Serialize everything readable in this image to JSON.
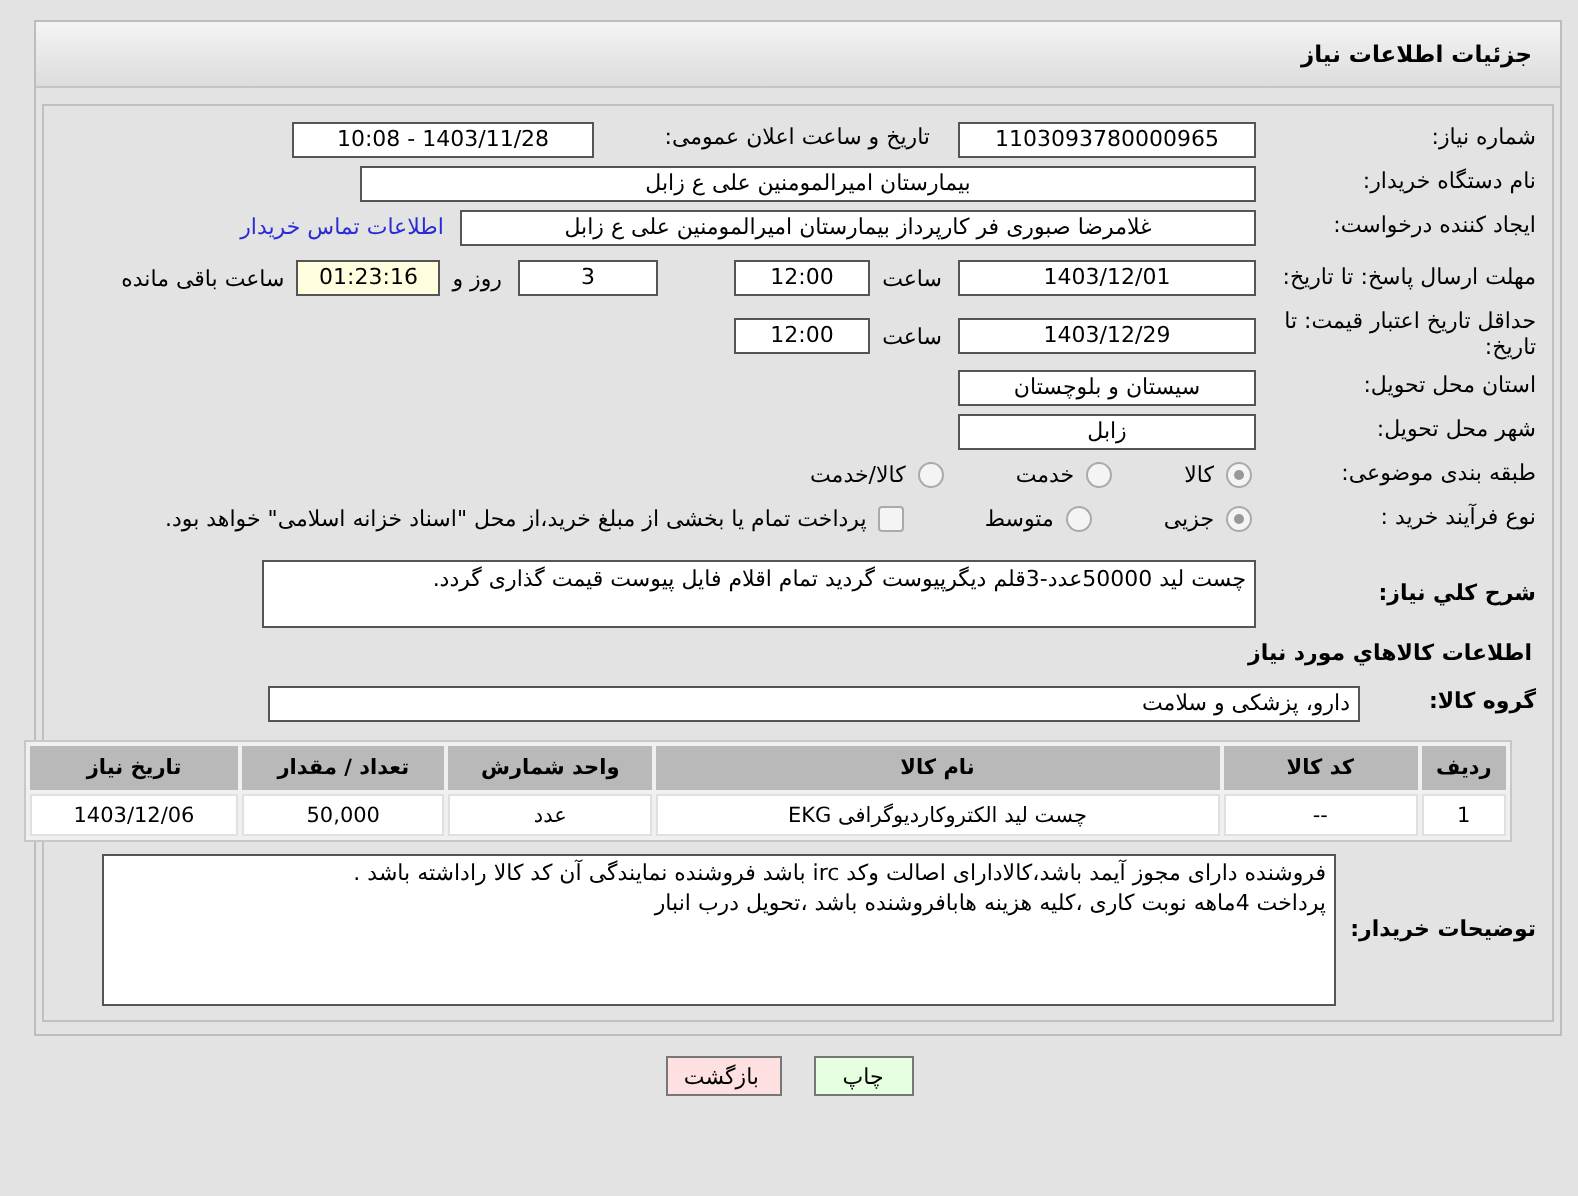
{
  "header": {
    "title": "جزئیات اطلاعات نیاز"
  },
  "need_number": {
    "label": "شماره نیاز:",
    "value": "1103093780000965"
  },
  "announce": {
    "label": "تاریخ و ساعت اعلان عمومی:",
    "value": "1403/11/28 - 10:08"
  },
  "buyer_org": {
    "label": "نام دستگاه خریدار:",
    "value": "بیمارستان امیرالمومنین علی  ع  زابل"
  },
  "creator": {
    "label": "ایجاد کننده درخواست:",
    "value": "غلامرضا صبوری فر کارپرداز بیمارستان امیرالمومنین علی  ع  زابل",
    "link": "اطلاعات تماس خریدار"
  },
  "reply_deadline": {
    "label": "مهلت ارسال پاسخ: تا تاریخ:",
    "date": "1403/12/01",
    "time_label": "ساعت",
    "time": "12:00",
    "days": "3",
    "days_label": "روز و",
    "remaining": "01:23:16",
    "remaining_label": "ساعت باقی مانده"
  },
  "price_validity": {
    "label": "حداقل تاریخ اعتبار قیمت: تا تاریخ:",
    "date": "1403/12/29",
    "time_label": "ساعت",
    "time": "12:00"
  },
  "province": {
    "label": "استان محل تحویل:",
    "value": "سیستان و بلوچستان"
  },
  "city": {
    "label": "شهر محل تحویل:",
    "value": "زابل"
  },
  "category": {
    "label": "طبقه بندی موضوعی:",
    "options": [
      {
        "label": "کالا",
        "selected": true
      },
      {
        "label": "خدمت",
        "selected": false
      },
      {
        "label": "کالا/خدمت",
        "selected": false
      }
    ]
  },
  "purchase_type": {
    "label": "نوع فرآیند خرید :",
    "options": [
      {
        "label": "جزیی",
        "selected": true
      },
      {
        "label": "متوسط",
        "selected": false
      }
    ],
    "treasury": {
      "label": "پرداخت تمام یا بخشی از مبلغ خرید،از محل \"اسناد خزانه اسلامی\" خواهد بود.",
      "checked": false
    }
  },
  "description": {
    "label": "شرح کلي نياز:",
    "value": "چست لید 50000عدد-3قلم دیگرپیوست گردید تمام اقلام فایل پیوست قیمت گذاری گردد."
  },
  "items_heading": "اطلاعات کالاهاي مورد نياز",
  "goods_group": {
    "label": "گروه کالا:",
    "value": "دارو، پزشکی و سلامت"
  },
  "table": {
    "columns": [
      "ردیف",
      "کد کالا",
      "نام کالا",
      "واحد شمارش",
      "تعداد / مقدار",
      "تاریخ نیاز"
    ],
    "rows": [
      [
        "1",
        "--",
        "چست لید الکتروکاردیوگرافی EKG",
        "عدد",
        "50,000",
        "1403/12/06"
      ]
    ]
  },
  "buyer_notes": {
    "label": "توضیحات خریدار:",
    "lines": [
      "فروشنده دارای مجوز آیمد باشد،کالادارای اصالت وکد irc باشد فروشنده نمایندگی آن کد کالا راداشته باشد .",
      "پرداخت 4ماهه نوبت کاری ،کلیه هزینه هابافروشنده باشد ،تحویل درب انبار"
    ]
  },
  "buttons": [
    {
      "label": "چاپ",
      "kind": "print"
    },
    {
      "label": "بازگشت",
      "kind": "back"
    }
  ]
}
